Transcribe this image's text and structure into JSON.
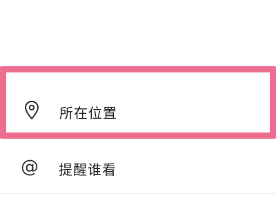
{
  "menu": {
    "items": [
      {
        "label": "所在位置",
        "icon": "location-pin-icon"
      },
      {
        "label": "提醒谁看",
        "icon": "at-icon"
      }
    ]
  },
  "colors": {
    "highlight": "#ee6e92",
    "text": "#222222",
    "divider": "#ececec"
  }
}
